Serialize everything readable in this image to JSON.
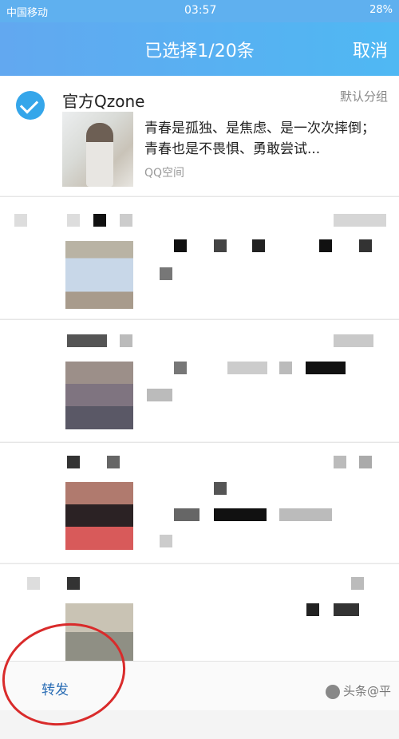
{
  "status_bar": {
    "carrier": "中国移动",
    "time": "03:57",
    "battery": "28%"
  },
  "header": {
    "title": "已选择1/20条",
    "cancel": "取消"
  },
  "selected_post": {
    "account": "官方Qzone",
    "group": "默认分组",
    "excerpt": "青春是孤独、是焦虑、是一次次摔倒；青春也是不畏惧、勇敢尝试...",
    "source": "QQ空间"
  },
  "bottom_bar": {
    "forward": "转发"
  },
  "watermark": "头条@平",
  "colors": {
    "accent": "#35a6ea",
    "header": "#5fb0ef",
    "annotation": "#d92b2b"
  }
}
